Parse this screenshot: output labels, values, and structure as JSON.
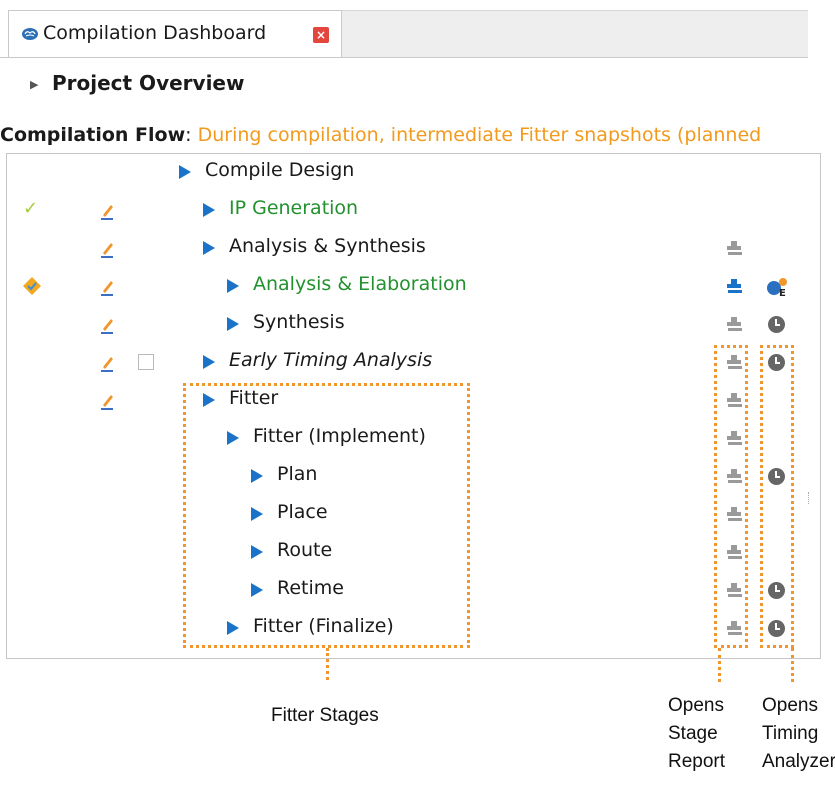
{
  "tab": {
    "title": "Compilation Dashboard",
    "close_glyph": "×",
    "icon": "brain-icon"
  },
  "overview": {
    "label": "Project Overview"
  },
  "flow": {
    "label": "Compilation Flow",
    "separator": ":",
    "message": " During compilation, intermediate Fitter snapshots (planned"
  },
  "tasks": [
    {
      "name": "Compile Design",
      "status": "",
      "report": false,
      "timing": ""
    },
    {
      "name": "IP Generation",
      "status": "complete",
      "report": false,
      "timing": ""
    },
    {
      "name": "Analysis & Synthesis",
      "status": "",
      "report": true,
      "timing": ""
    },
    {
      "name": "Analysis & Elaboration",
      "status": "warning",
      "report": true,
      "timing": "color"
    },
    {
      "name": "Synthesis",
      "status": "",
      "report": true,
      "timing": "clock"
    },
    {
      "name": "Early Timing Analysis",
      "status": "",
      "report": true,
      "timing": "clock"
    },
    {
      "name": "Fitter",
      "status": "",
      "report": true,
      "timing": ""
    },
    {
      "name": "Fitter (Implement)",
      "status": "",
      "report": true,
      "timing": ""
    },
    {
      "name": "Plan",
      "status": "",
      "report": true,
      "timing": "clock"
    },
    {
      "name": "Place",
      "status": "",
      "report": true,
      "timing": ""
    },
    {
      "name": "Route",
      "status": "",
      "report": true,
      "timing": ""
    },
    {
      "name": "Retime",
      "status": "",
      "report": true,
      "timing": "clock"
    },
    {
      "name": "Fitter (Finalize)",
      "status": "",
      "report": true,
      "timing": "clock"
    }
  ],
  "annotations": {
    "fitter_stages": "Fitter Stages",
    "stage_report": [
      "Opens",
      "Stage",
      "Report"
    ],
    "timing_analyzer": [
      "Opens",
      "Timing",
      "Analyzer"
    ]
  },
  "colors": {
    "accent_blue": "#1a73c9",
    "complete_green": "#22912e",
    "flow_message_orange": "#f29a1d",
    "annotation_orange": "#f0962d"
  }
}
